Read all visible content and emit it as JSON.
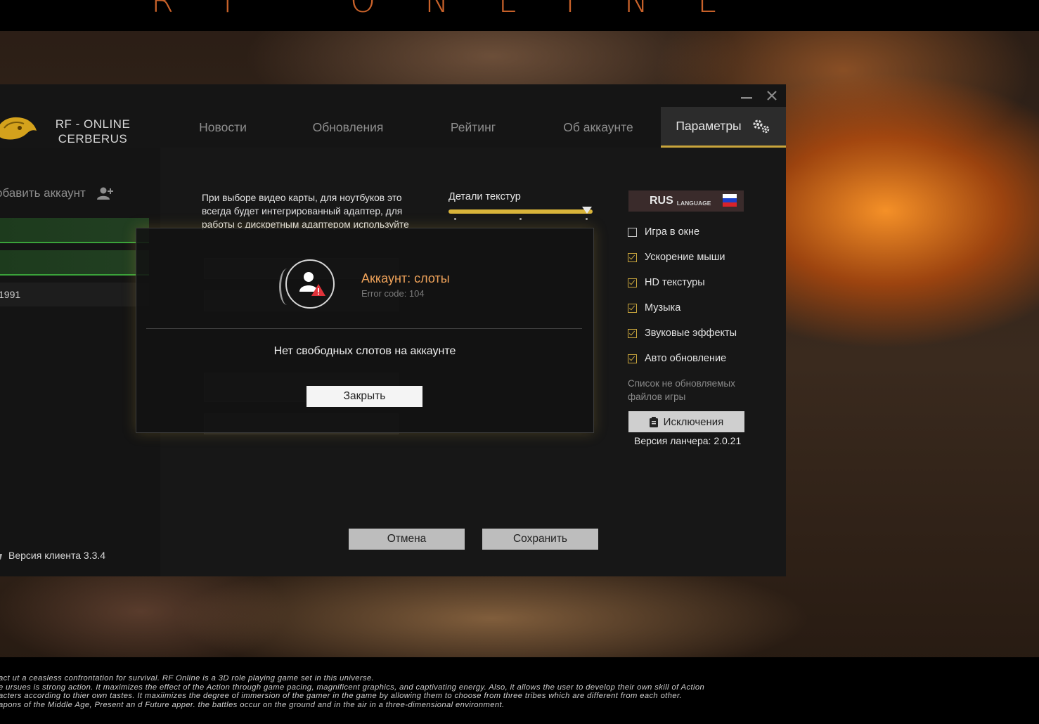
{
  "header": {
    "logo_text": "RF ONLINE"
  },
  "window": {
    "minimize_icon": "minimize-icon",
    "close_icon": "close-icon"
  },
  "brand": {
    "line1": "RF - ONLINE",
    "line2": "CERBERUS"
  },
  "tabs": [
    {
      "label": "Новости"
    },
    {
      "label": "Обновления"
    },
    {
      "label": "Рейтинг"
    },
    {
      "label": "Об аккаунте"
    },
    {
      "label": "Параметры",
      "active": true
    }
  ],
  "sidebar": {
    "add_account": "обавить аккаунт",
    "account_row_text": "1991",
    "client_version": "Версия клиента 3.3.4"
  },
  "settings": {
    "gpu_info": "При выборе видео карты, для ноутбуков это всегда будет интегрированный адаптер, для работы с дискретным адаптером используйте",
    "sliders": [
      {
        "label": "Детали текстур",
        "value": 1.0
      }
    ],
    "language": {
      "code": "RUS",
      "sub": "LANGUAGE"
    },
    "checkboxes": [
      {
        "label": "Игра в окне",
        "checked": false
      },
      {
        "label": "Ускорение мыши",
        "checked": true
      },
      {
        "label": "HD текстуры",
        "checked": true
      },
      {
        "label": "Музыка",
        "checked": true
      },
      {
        "label": "Звуковые эффекты",
        "checked": true
      },
      {
        "label": "Авто обновление",
        "checked": true
      }
    ],
    "exclusions_note": "Список не обновляемых файлов игры",
    "exclusions_button": "Исключения",
    "launcher_version": "Версия ланчера: 2.0.21",
    "cancel_button": "Отмена",
    "save_button": "Сохранить"
  },
  "dialog": {
    "title": "Аккаунт: слоты",
    "error_code": "Error code: 104",
    "message": "Нет свободных слотов на аккаунте",
    "close_button": "Закрыть"
  },
  "footer": {
    "line1": "act ut a ceasless confrontation for survival. RF Online is a 3D role playing game set in this universe.",
    "line2": "e ursues is strong action. It maximizes the effect of the Action through game pacing, magnificent graphics, and captivating energy. Also, it allows the user to develop their own skill of Action",
    "line3": "acters according to thier own tastes. It maxiimizes the degree of immersion of the gamer in the game by allowing them to choose from three  tribes which are different from each other.",
    "line4": "apons of the Middle Age, Present an d Future apper. the battles occur on the ground and in the air in a three-dimensional environment."
  },
  "colors": {
    "accent": "#c9a53c",
    "error": "#f0a35a",
    "green": "#3aa23a"
  }
}
